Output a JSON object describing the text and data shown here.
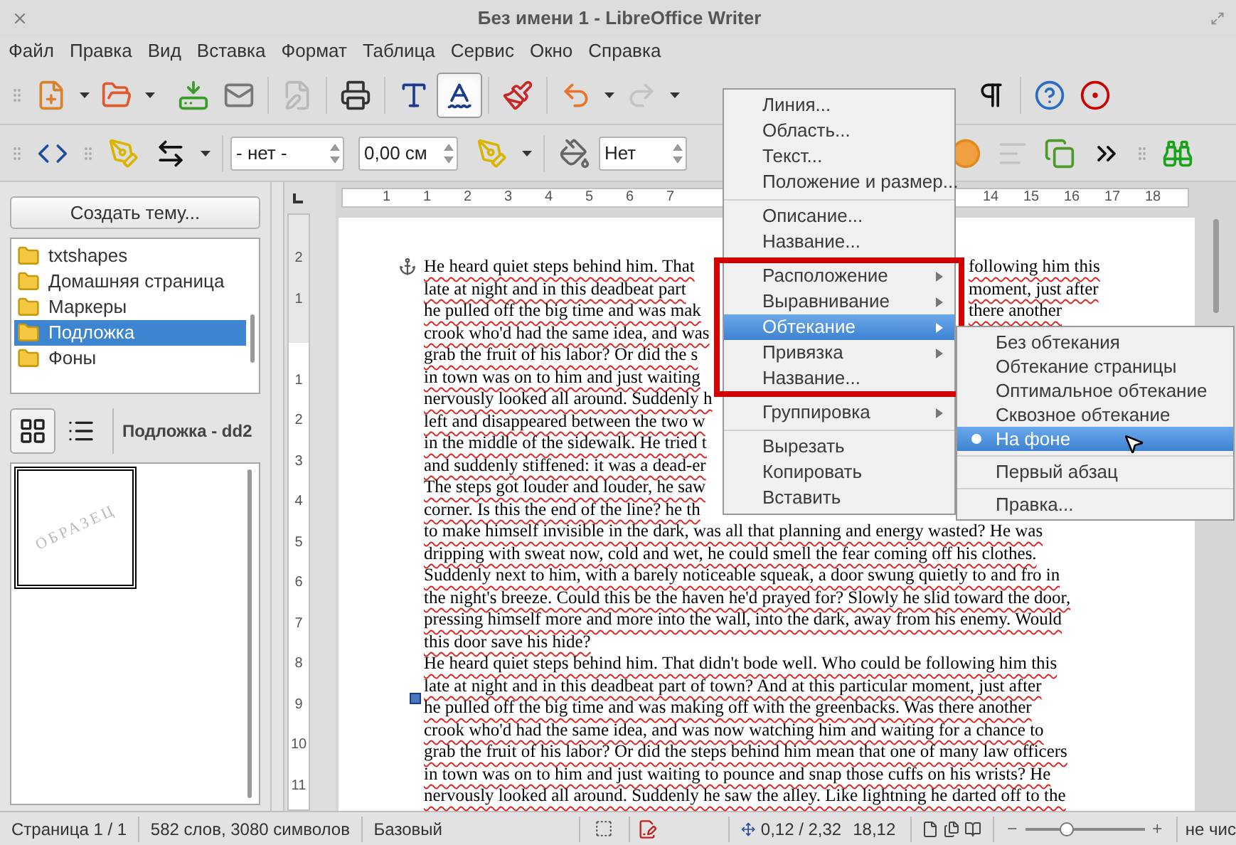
{
  "window": {
    "title": "Без имени 1 - LibreOffice Writer"
  },
  "menu_bar": [
    {
      "label": "Файл"
    },
    {
      "label": "Правка"
    },
    {
      "label": "Вид"
    },
    {
      "label": "Вставка"
    },
    {
      "label": "Формат"
    },
    {
      "label": "Таблица"
    },
    {
      "label": "Сервис"
    },
    {
      "label": "Окно"
    },
    {
      "label": "Справка"
    }
  ],
  "standard_toolbar": [
    {
      "pressed": false,
      "disabled": false,
      "dropdown": true
    },
    {
      "pressed": false,
      "disabled": false,
      "dropdown": true
    },
    {
      "pressed": false,
      "disabled": false,
      "dropdown": false
    },
    {
      "pressed": false,
      "disabled": false,
      "dropdown": false
    },
    {
      "pressed": false,
      "disabled": true,
      "dropdown": false
    },
    {
      "pressed": false,
      "disabled": false,
      "dropdown": false
    },
    {
      "pressed": false,
      "disabled": false,
      "dropdown": false
    },
    {
      "pressed": true,
      "disabled": false,
      "dropdown": false
    },
    {
      "pressed": false,
      "disabled": false,
      "dropdown": false
    },
    {
      "pressed": false,
      "disabled": false,
      "dropdown": true
    },
    {
      "pressed": false,
      "disabled": true,
      "dropdown": true
    },
    {
      "pressed": false,
      "disabled": false,
      "dropdown": false
    },
    {
      "pressed": false,
      "disabled": false,
      "dropdown": false
    },
    {
      "pressed": false,
      "disabled": false,
      "dropdown": false
    }
  ],
  "drawing_toolbar": {
    "tools": [
      {
        "pressed": false,
        "disabled": false,
        "dropdown": false
      },
      {
        "pressed": false,
        "disabled": false,
        "dropdown": false
      },
      {
        "pressed": false,
        "disabled": false,
        "dropdown": true
      },
      {
        "pressed": false,
        "disabled": false,
        "dropdown": true
      },
      {
        "pressed": false,
        "disabled": false,
        "dropdown": false
      },
      {
        "pressed": false,
        "disabled": false,
        "dropdown": false
      },
      {
        "pressed": false,
        "disabled": true,
        "dropdown": false
      },
      {
        "pressed": false,
        "disabled": false,
        "dropdown": false
      },
      {
        "pressed": false,
        "disabled": false,
        "dropdown": false
      },
      {
        "pressed": false,
        "disabled": false,
        "dropdown": false
      }
    ],
    "line_style": "- нет -",
    "line_width": "0,00 см",
    "area_style": "Нет"
  },
  "sidebar": {
    "new_theme_button": "Создать тему...",
    "themes": [
      {
        "label": "txtshapes",
        "selected": false
      },
      {
        "label": "Домашняя страница",
        "selected": false
      },
      {
        "label": "Маркеры",
        "selected": false
      },
      {
        "label": "Подложка",
        "selected": true
      },
      {
        "label": "Фоны",
        "selected": false
      }
    ],
    "view_modes": [
      {
        "selected": true
      },
      {
        "selected": false
      }
    ],
    "theme_title": "Подложка - dd2",
    "items": [
      {
        "label": "ОБРАЗЕЦ"
      }
    ]
  },
  "horizontal_ruler": {
    "left_labels": [
      "1",
      "1",
      "2",
      "3",
      "4",
      "5",
      "6",
      "7"
    ],
    "right_labels": [
      "14",
      "15",
      "16",
      "17",
      "18"
    ]
  },
  "vertical_ruler": {
    "top_margin_labels": [
      "2",
      "1"
    ],
    "labels": [
      "1",
      "2",
      "3",
      "4",
      "5",
      "6",
      "7",
      "8",
      "9",
      "10",
      "11"
    ]
  },
  "document": {
    "spellcheck_marks": true,
    "lines": [
      {
        "text": "He heard quiet steps behind him. That",
        "right": "following him this"
      },
      {
        "text": "late at night and in this deadbeat part",
        "right": "moment, just after"
      },
      {
        "text": "he pulled off the big time and was mak",
        "right": "there another"
      },
      {
        "text": "crook who'd had the same idea, and was"
      },
      {
        "text": "grab the fruit of his labor? Or did the s"
      },
      {
        "text": "in town was on to him and just waiting"
      },
      {
        "text": "nervously looked all around. Suddenly h"
      },
      {
        "text": "left and disappeared between the two w"
      },
      {
        "text": "in the middle of the sidewalk. He tried t"
      },
      {
        "text": "and suddenly stiffened: it was a dead-er"
      },
      {
        "text": "The steps got louder and louder, he saw"
      },
      {
        "text": "corner. Is this the end of the line? he th"
      },
      {
        "text": "to make himself invisible in the dark, was all that planning and energy wasted? He was"
      },
      {
        "text": "dripping with sweat now, cold and wet, he could smell the fear coming off his clothes."
      },
      {
        "text": "Suddenly next to him, with a barely noticeable squeak, a door swung quietly to and fro in"
      },
      {
        "text": "the night's breeze. Could this be the haven he'd prayed for? Slowly he slid toward the door,"
      },
      {
        "text": "pressing himself more and more into the wall, into the dark, away from his enemy. Would"
      },
      {
        "text": "this door save his hide?"
      },
      {
        "text": "He heard quiet steps behind him. That didn't bode well. Who could be following him this"
      },
      {
        "text": "late at night and in this deadbeat part of town? And at this particular moment, just after"
      },
      {
        "text": "he pulled off the big time and was making off with the greenbacks. Was there another"
      },
      {
        "text": "crook who'd had the same idea, and was now watching him and waiting for a chance to"
      },
      {
        "text": "grab the fruit of his labor? Or did the steps behind him mean that one of many law officers"
      },
      {
        "text": "in town was on to him and just waiting to pounce and snap those cuffs on his wrists? He"
      },
      {
        "text": "nervously looked all around. Suddenly he saw the alley. Like lightning he darted off to the"
      }
    ]
  },
  "context_menu": {
    "items": [
      {
        "kind": "item",
        "label": "Линия...",
        "highlighted": false
      },
      {
        "kind": "item",
        "label": "Область...",
        "highlighted": false
      },
      {
        "kind": "item",
        "label": "Текст...",
        "highlighted": false
      },
      {
        "kind": "item",
        "label": "Положение и размер...",
        "highlighted": false
      },
      {
        "kind": "separator"
      },
      {
        "kind": "item",
        "label": "Описание...",
        "highlighted": false
      },
      {
        "kind": "item",
        "label": "Название...",
        "highlighted": false
      },
      {
        "kind": "separator"
      },
      {
        "kind": "group",
        "framed": true,
        "children": [
          {
            "kind": "submenu",
            "label": "Расположение",
            "highlighted": false
          },
          {
            "kind": "submenu",
            "label": "Выравнивание",
            "highlighted": false
          },
          {
            "kind": "submenu",
            "label": "Обтекание",
            "highlighted": true
          },
          {
            "kind": "submenu",
            "label": "Привязка",
            "highlighted": false
          },
          {
            "kind": "item",
            "label": "Название...",
            "highlighted": false
          }
        ]
      },
      {
        "kind": "separator"
      },
      {
        "kind": "submenu",
        "label": "Группировка",
        "highlighted": false
      },
      {
        "kind": "separator"
      },
      {
        "kind": "item",
        "label": "Вырезать",
        "highlighted": false
      },
      {
        "kind": "item",
        "label": "Копировать",
        "highlighted": false
      },
      {
        "kind": "item",
        "label": "Вставить",
        "highlighted": false
      }
    ]
  },
  "wrap_submenu": {
    "items": [
      {
        "kind": "radio",
        "label": "Без обтекания",
        "checked": false,
        "highlighted": false
      },
      {
        "kind": "radio",
        "label": "Обтекание страницы",
        "checked": false,
        "highlighted": false
      },
      {
        "kind": "radio",
        "label": "Оптимальное обтекание",
        "checked": false,
        "highlighted": false
      },
      {
        "kind": "radio",
        "label": "Сквозное обтекание",
        "checked": false,
        "highlighted": false
      },
      {
        "kind": "radio",
        "label": "На фоне",
        "checked": true,
        "highlighted": true
      },
      {
        "kind": "separator"
      },
      {
        "kind": "check",
        "label": "Первый абзац",
        "checked": false,
        "highlighted": false
      },
      {
        "kind": "separator"
      },
      {
        "kind": "item",
        "label": "Правка...",
        "highlighted": false
      }
    ]
  },
  "status_bar": {
    "page": "Страница 1 / 1",
    "word_count": "582 слов, 3080 символов",
    "page_style": "Базовый",
    "position": "0,12 / 2,32",
    "size": "18,12",
    "zoom": {
      "level": 0.35
    },
    "zoom_text": "не чис"
  }
}
